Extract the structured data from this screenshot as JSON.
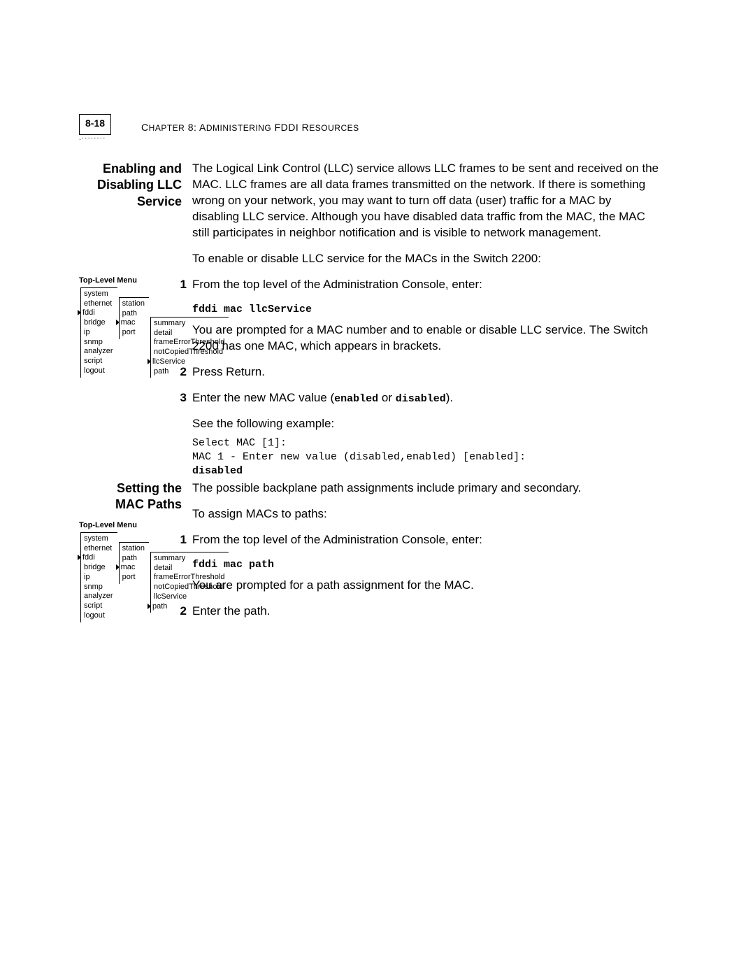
{
  "header": {
    "page_num": "8-18",
    "chapter_prefix": "C",
    "chapter_text1": "HAPTER",
    "chapter_num": " 8: A",
    "chapter_text2": "DMINISTERING",
    "chapter_text3": " FDDI R",
    "chapter_text4": "ESOURCES"
  },
  "section1": {
    "heading_line1": "Enabling and",
    "heading_line2": "Disabling LLC",
    "heading_line3": "Service",
    "para1": "The Logical Link Control (LLC) service allows LLC frames to be sent and received on the MAC. LLC frames are all data frames transmitted on the network. If there is something wrong on your network, you may want to turn off data (user) traffic for a MAC by disabling LLC service. Although you have disabled data traffic from the MAC, the MAC still participates in neighbor notification and is visible to network management.",
    "para2": "To enable or disable LLC service for the MACs in the Switch 2200:",
    "step1_num": "1",
    "step1_text": "From the top level of the Administration Console, enter:",
    "step1_cmd": "fddi mac llcService",
    "step1_para": "You are prompted for a MAC number and to enable or disable LLC service. The Switch 2200 has one MAC, which appears in brackets.",
    "step2_num": "2",
    "step2_text": "Press Return.",
    "step3_num": "3",
    "step3_text_a": "Enter the new MAC value (",
    "step3_enabled": "enabled",
    "step3_or": " or ",
    "step3_disabled": "disabled",
    "step3_text_b": ").",
    "step3_para": "See the following example:",
    "example_line1": "Select MAC [1]:",
    "example_line2": "MAC 1 - Enter new value (disabled,enabled) [enabled]:",
    "example_line3": "disabled"
  },
  "section2": {
    "heading_line1": "Setting the",
    "heading_line2": "MAC Paths",
    "para1": "The possible backplane path assignments include primary and secondary.",
    "para2": "To assign MACs to paths:",
    "step1_num": "1",
    "step1_text": "From the top level of the Administration Console, enter:",
    "step1_cmd": "fddi mac path",
    "step1_para": "You are prompted for a path assignment for the MAC.",
    "step2_num": "2",
    "step2_text": "Enter the path."
  },
  "menu": {
    "title": "Top-Level Menu",
    "col1": [
      "system",
      "ethernet",
      "fddi",
      "bridge",
      "ip",
      "snmp",
      "analyzer",
      "script",
      "logout"
    ],
    "col1_arrow_index": 2,
    "col2": [
      "station",
      "path",
      "mac",
      "port"
    ],
    "col2_arrow_index": 2,
    "col3": [
      "summary",
      "detail",
      "frameErrorThreshold",
      "notCopiedThreshold",
      "llcService",
      "path"
    ],
    "col3_arrow_index_a": 4,
    "col3_arrow_index_b": 5
  }
}
